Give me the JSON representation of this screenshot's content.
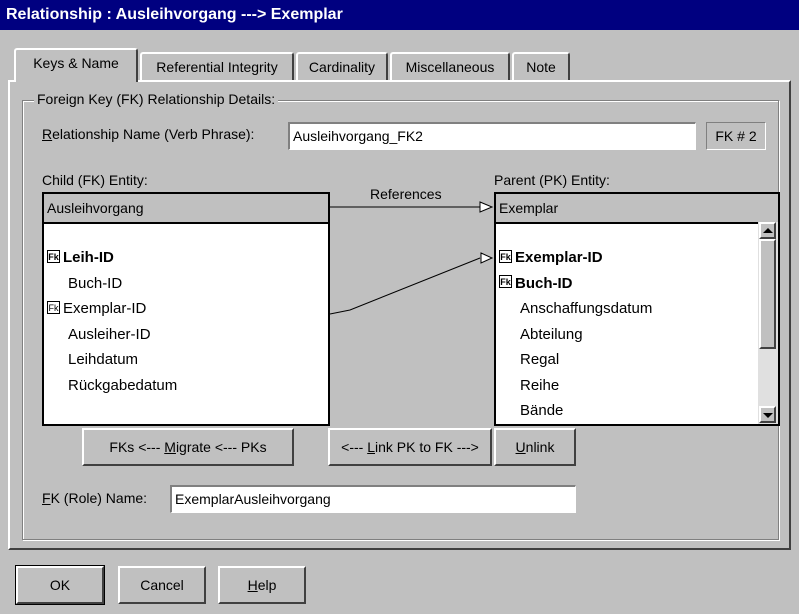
{
  "window": {
    "title": "Relationship : Ausleihvorgang ---> Exemplar"
  },
  "tabs": [
    {
      "label": "Keys & Name",
      "active": true
    },
    {
      "label": "Referential Integrity"
    },
    {
      "label": "Cardinality"
    },
    {
      "label": "Miscellaneous"
    },
    {
      "label": "Note"
    }
  ],
  "group": {
    "title": "Foreign Key (FK) Relationship Details:"
  },
  "relationship": {
    "label_pre": "",
    "label_ul": "R",
    "label_post": "elationship Name (Verb Phrase):",
    "value": "Ausleihvorgang_FK2",
    "fk_number": "FK # 2"
  },
  "child": {
    "label": "Child (FK) Entity:",
    "name": "Ausleihvorgang",
    "attributes": [
      {
        "name": "Leih-ID",
        "fk": true,
        "bold": true
      },
      {
        "name": "Buch-ID",
        "fk": false,
        "bold": false
      },
      {
        "name": "Exemplar-ID",
        "fk": true,
        "bold": false
      },
      {
        "name": "Ausleiher-ID",
        "fk": false,
        "bold": false
      },
      {
        "name": "Leihdatum",
        "fk": false,
        "bold": false
      },
      {
        "name": "Rückgabedatum",
        "fk": false,
        "bold": false
      }
    ]
  },
  "parent": {
    "label": "Parent (PK) Entity:",
    "name": "Exemplar",
    "attributes": [
      {
        "name": "Exemplar-ID",
        "fk": true,
        "bold": true
      },
      {
        "name": "Buch-ID",
        "fk": true,
        "bold": true
      },
      {
        "name": "Anschaffungsdatum",
        "fk": false,
        "bold": false
      },
      {
        "name": "Abteilung",
        "fk": false,
        "bold": false
      },
      {
        "name": "Regal",
        "fk": false,
        "bold": false
      },
      {
        "name": "Reihe",
        "fk": false,
        "bold": false
      },
      {
        "name": "Bände",
        "fk": false,
        "bold": false
      }
    ]
  },
  "references_label": "References",
  "fk_badge": "Fk",
  "buttons": {
    "migrate": {
      "pre": "FKs <--- ",
      "ul": "M",
      "post": "igrate <--- PKs"
    },
    "link": {
      "pre": "<--- ",
      "ul": "L",
      "post": "ink PK to FK --->"
    },
    "unlink": {
      "pre": "",
      "ul": "U",
      "post": "nlink"
    },
    "ok": "OK",
    "cancel": "Cancel",
    "help": {
      "pre": "",
      "ul": "H",
      "post": "elp"
    }
  },
  "role": {
    "label_pre": "",
    "label_ul": "F",
    "label_post": "K (Role) Name:",
    "value": "ExemplarAusleihvorgang"
  }
}
